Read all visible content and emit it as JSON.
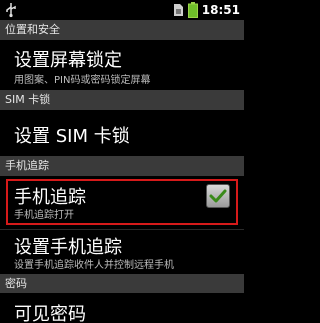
{
  "status_bar": {
    "time": "18:51",
    "icons": [
      "usb-icon",
      "sim-icon",
      "battery-icon"
    ]
  },
  "sections": {
    "location_security": "位置和安全",
    "sim_lock": "SIM 卡锁",
    "mobile_tracker": "手机追踪",
    "passwords": "密码"
  },
  "items": {
    "screen_lock": {
      "title": "设置屏幕锁定",
      "summary": "用图案、PIN码或密码锁定屏幕"
    },
    "sim_lock": {
      "title": "设置 SIM 卡锁"
    },
    "mobile_tracker": {
      "title": "手机追踪",
      "summary": "手机追踪打开",
      "checked": true
    },
    "set_mobile_tracker": {
      "title": "设置手机追踪",
      "summary": "设置手机追踪收件人并控制远程手机"
    },
    "visible_passwords": {
      "title": "可见密码"
    }
  },
  "colors": {
    "highlight": "#d61a1a",
    "check": "#3a8a1a",
    "section_bg": "#3a3a3a"
  }
}
